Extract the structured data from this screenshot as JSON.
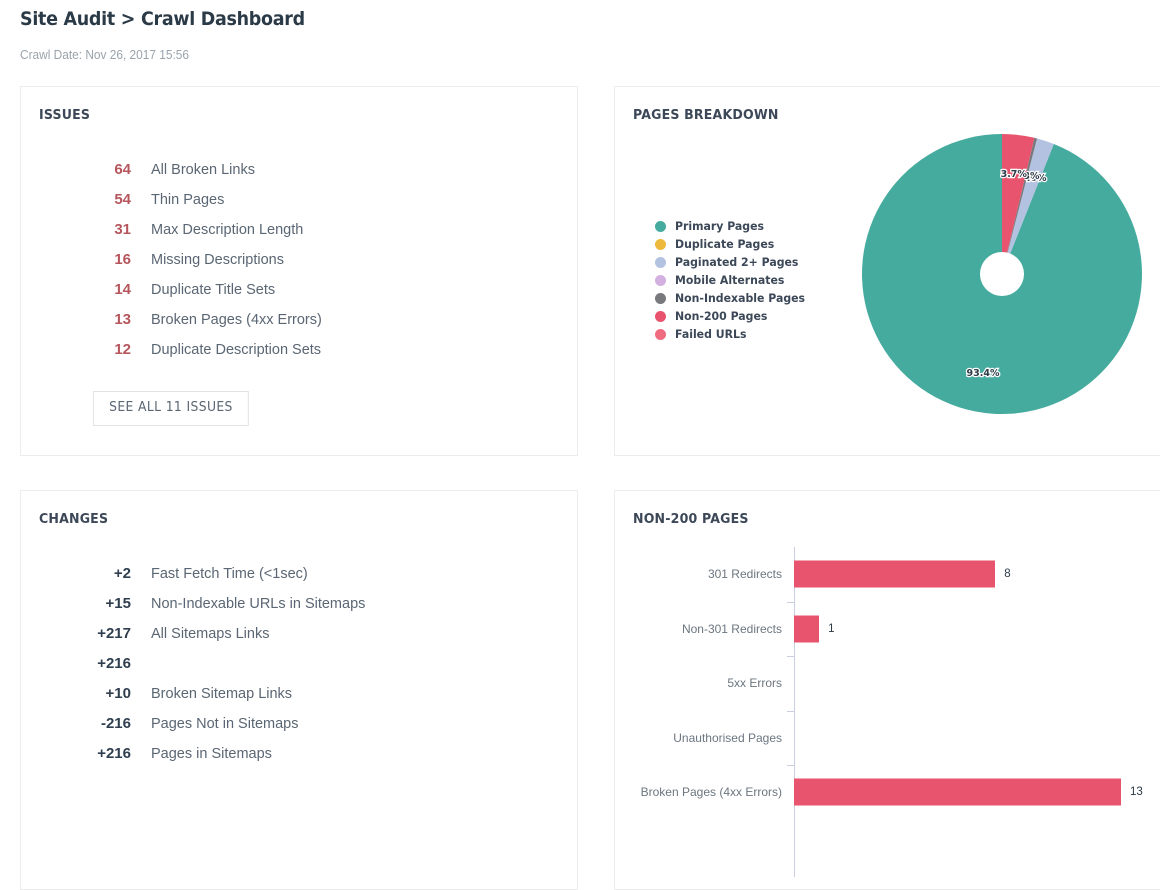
{
  "header": {
    "title": "Site Audit > Crawl Dashboard",
    "crawl_date": "Crawl Date: Nov 26, 2017 15:56"
  },
  "issues_panel": {
    "title": "ISSUES",
    "rows": [
      {
        "value": "64",
        "label": "All Broken Links"
      },
      {
        "value": "54",
        "label": "Thin Pages"
      },
      {
        "value": "31",
        "label": "Max Description Length"
      },
      {
        "value": "16",
        "label": "Missing Descriptions"
      },
      {
        "value": "14",
        "label": "Duplicate Title Sets"
      },
      {
        "value": "13",
        "label": "Broken Pages (4xx Errors)"
      },
      {
        "value": "12",
        "label": "Duplicate Description Sets"
      }
    ],
    "see_all_label": "SEE ALL 11 ISSUES",
    "value_color": "#b6565c"
  },
  "changes_panel": {
    "title": "CHANGES",
    "rows": [
      {
        "value": "+2",
        "label": "Fast Fetch Time (<1sec)"
      },
      {
        "value": "+15",
        "label": "Non-Indexable URLs in Sitemaps"
      },
      {
        "value": "+217",
        "label": "All Sitemaps Links"
      },
      {
        "value": "+216",
        "label": ""
      },
      {
        "value": "+10",
        "label": "Broken Sitemap Links"
      },
      {
        "value": "-216",
        "label": "Pages Not in Sitemaps"
      },
      {
        "value": "+216",
        "label": "Pages in Sitemaps"
      }
    ]
  },
  "pages_panel": {
    "title": "PAGES BREAKDOWN"
  },
  "non200_panel": {
    "title": "NON-200 PAGES"
  },
  "chart_data": [
    {
      "type": "pie",
      "title": "PAGES BREAKDOWN",
      "legend_position": "left",
      "donut_hole": true,
      "categories": [
        "Primary Pages",
        "Duplicate Pages",
        "Paginated 2+ Pages",
        "Mobile Alternates",
        "Non-Indexable Pages",
        "Non-200 Pages",
        "Failed URLs"
      ],
      "values": [
        93.4,
        0,
        2.0,
        0,
        0.3,
        3.7,
        0
      ],
      "labels": [
        "93.4%",
        "",
        "2.0%",
        "",
        "0.3%",
        "3.7%",
        ""
      ],
      "colors": [
        "#45ab9e",
        "#edb93c",
        "#b3c2e0",
        "#d2b0e0",
        "#77797c",
        "#e8546e",
        "#ee6b80"
      ]
    },
    {
      "type": "bar",
      "orientation": "horizontal",
      "title": "NON-200 PAGES",
      "xlabel": "",
      "ylabel": "",
      "grid": false,
      "xlim": [
        0,
        13
      ],
      "categories": [
        "301 Redirects",
        "Non-301 Redirects",
        "5xx Errors",
        "Unauthorised Pages",
        "Broken Pages (4xx Errors)"
      ],
      "values": [
        8,
        1,
        0,
        0,
        13
      ],
      "value_labels": [
        "8",
        "1",
        "",
        "",
        "13"
      ],
      "bar_color": "#e8546e"
    }
  ]
}
